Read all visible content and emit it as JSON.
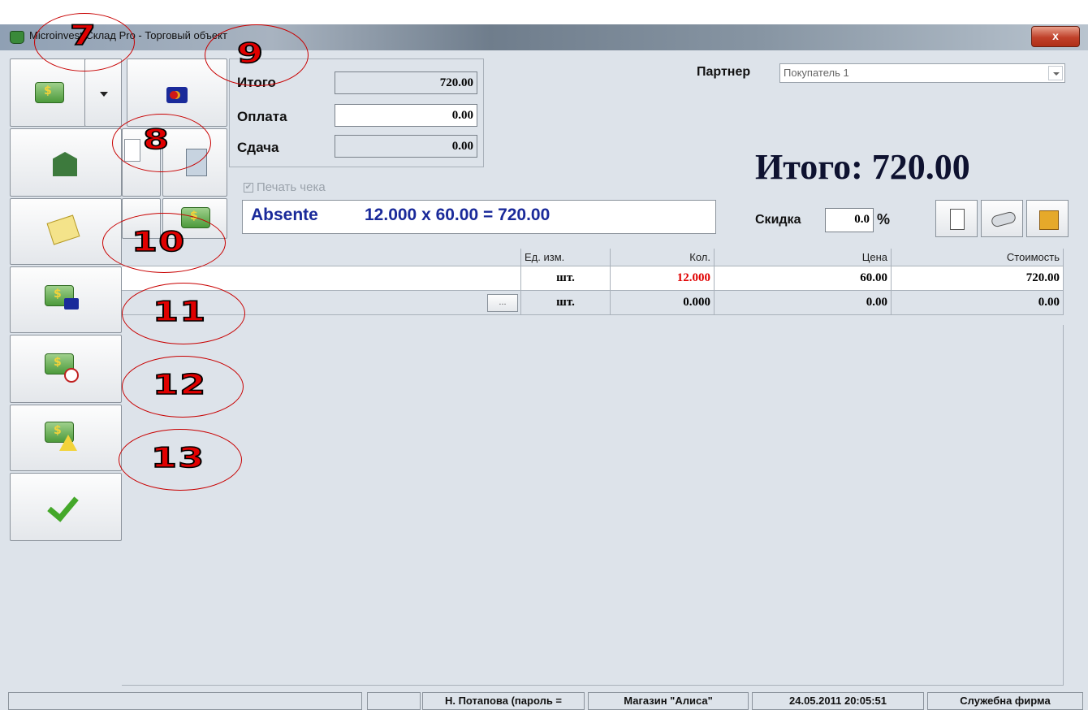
{
  "window": {
    "title": "Microinvest Склад Pro - Торговый объект",
    "close": "x"
  },
  "payment": {
    "total_label": "Итого",
    "total_value": "720.00",
    "pay_label": "Оплата",
    "pay_value": "0.00",
    "change_label": "Сдача",
    "change_value": "0.00"
  },
  "partner": {
    "label": "Партнер",
    "value": "Покупатель 1"
  },
  "big_total": "Итого:  720.00",
  "print_receipt": {
    "label": "Печать чека",
    "checked": "✔"
  },
  "current_line": {
    "name": "Absente",
    "formula": "12.000  x  60.00  =  720.00"
  },
  "discount": {
    "label": "Скидка",
    "value": "0.0",
    "unit": "%"
  },
  "table": {
    "headers": [
      "Ед. изм.",
      "Кол.",
      "Цена",
      "Стоимость"
    ],
    "rows": [
      {
        "unit": "шт.",
        "qty": "12.000",
        "price": "60.00",
        "cost": "720.00"
      },
      {
        "unit": "шт.",
        "qty": "0.000",
        "price": "0.00",
        "cost": "0.00",
        "more": "..."
      }
    ]
  },
  "callouts": [
    "7",
    "8",
    "9",
    "10",
    "11",
    "12",
    "13"
  ],
  "status": [
    "",
    "",
    "Н. Потапова  (пароль =",
    "Магазин \"Алиса\"",
    "24.05.2011 20:05:51",
    "Служебна фирма"
  ],
  "colors": {
    "qty_red": "#e00000",
    "info_blue": "#1a2a9a",
    "callout_red": "#e00000"
  },
  "icons": [
    "cash-icon",
    "dropdown-arrow-icon",
    "card-icon",
    "bank-icon",
    "note-icon",
    "card-money-icon",
    "clock-money-icon",
    "alert-money-icon",
    "checkmark-icon",
    "receipt-icon",
    "eraser-icon",
    "box-icon"
  ]
}
